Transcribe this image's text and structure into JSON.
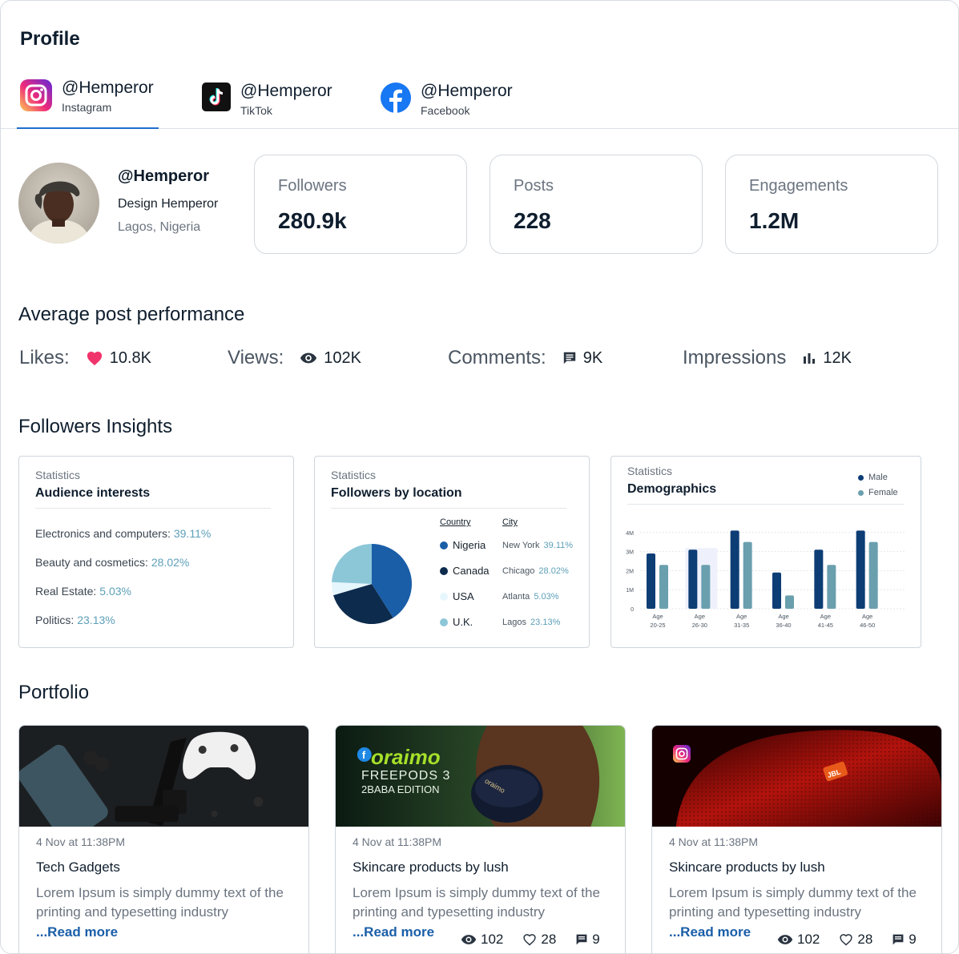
{
  "page": {
    "title": "Profile"
  },
  "tabs": [
    {
      "handle": "@Hemperor",
      "platform": "Instagram"
    },
    {
      "handle": "@Hemperor",
      "platform": "TikTok"
    },
    {
      "handle": "@Hemperor",
      "platform": "Facebook"
    }
  ],
  "profile": {
    "handle": "@Hemperor",
    "name": "Design Hemperor",
    "location": "Lagos, Nigeria"
  },
  "stats": [
    {
      "label": "Followers",
      "value": "280.9k"
    },
    {
      "label": "Posts",
      "value": "228"
    },
    {
      "label": "Engagements",
      "value": "1.2M"
    }
  ],
  "performance": {
    "title": "Average post performance",
    "likes_label": "Likes:",
    "likes": "10.8K",
    "views_label": "Views:",
    "views": "102K",
    "comments_label": "Comments:",
    "comments": "9K",
    "impressions_label": "Impressions",
    "impressions": "12K"
  },
  "insights": {
    "title": "Followers Insights",
    "interests": {
      "sub": "Statistics",
      "title": "Audience interests",
      "items": [
        {
          "label": "Electronics and computers:",
          "pct": "39.11%"
        },
        {
          "label": "Beauty and cosmetics:",
          "pct": "28.02%"
        },
        {
          "label": "Real Estate:",
          "pct": "5.03%"
        },
        {
          "label": "Politics:",
          "pct": "23.13%"
        }
      ]
    },
    "location": {
      "sub": "Statistics",
      "title": "Followers by location",
      "country_header": "Country",
      "city_header": "City",
      "rows": [
        {
          "country": "Nigeria",
          "city": "New York",
          "pct": "39.11%",
          "color": "#1a5ea8"
        },
        {
          "country": "Canada",
          "city": "Chicago",
          "pct": "28.02%",
          "color": "#0d2b4d"
        },
        {
          "country": "USA",
          "city": "Atlanta",
          "pct": "5.03%",
          "color": "#e6f6fd"
        },
        {
          "country": "U.K.",
          "city": "Lagos",
          "pct": "23.13%",
          "color": "#8cc7d8"
        }
      ]
    },
    "demographics": {
      "sub": "Statistics",
      "title": "Demographics",
      "legend": [
        {
          "name": "Male",
          "color": "#0d3d75"
        },
        {
          "name": "Female",
          "color": "#6a9fae"
        }
      ]
    }
  },
  "chart_data": [
    {
      "type": "pie",
      "labels": [
        "Nigeria",
        "Canada",
        "USA",
        "U.K."
      ],
      "values": [
        39.11,
        28.02,
        5.03,
        23.13
      ],
      "colors": [
        "#1a5ea8",
        "#0d2b4d",
        "#e6f6fd",
        "#8cc7d8"
      ]
    },
    {
      "type": "bar",
      "categories": [
        "Age\n20-25",
        "Age\n26-30",
        "Age\n31-35",
        "Age\n36-40",
        "Age\n41-45",
        "Age\n46-50"
      ],
      "series": [
        {
          "name": "Male",
          "values": [
            2.9,
            3.1,
            4.1,
            1.9,
            3.1,
            4.1
          ]
        },
        {
          "name": "Female",
          "values": [
            2.3,
            2.3,
            3.5,
            0.7,
            2.3,
            3.5
          ]
        }
      ],
      "yticks": [
        "0",
        "1M",
        "2M",
        "3M",
        "4M"
      ],
      "ylim": [
        0,
        4.2
      ]
    }
  ],
  "portfolio": {
    "title": "Portfolio",
    "items": [
      {
        "date": "4 Nov at 11:38PM",
        "title": "Tech Gadgets",
        "body": "Lorem Ipsum is simply dummy text of the printing and typesetting industry",
        "more": "...Read more"
      },
      {
        "date": "4 Nov at 11:38PM",
        "title": "Skincare products by lush",
        "body": "Lorem Ipsum is simply dummy text of the printing and typesetting industry",
        "more": "...Read more",
        "views": "102",
        "likes": "28",
        "comments": "9",
        "brand": "oraimo",
        "line1": "FREEPODS 3",
        "line2": "2BABA EDITION"
      },
      {
        "date": "4 Nov at 11:38PM",
        "title": "Skincare products by lush",
        "body": "Lorem Ipsum is simply dummy text of the printing and typesetting industry",
        "more": "...Read more",
        "views": "102",
        "likes": "28",
        "comments": "9",
        "brand": "JBL"
      }
    ]
  }
}
